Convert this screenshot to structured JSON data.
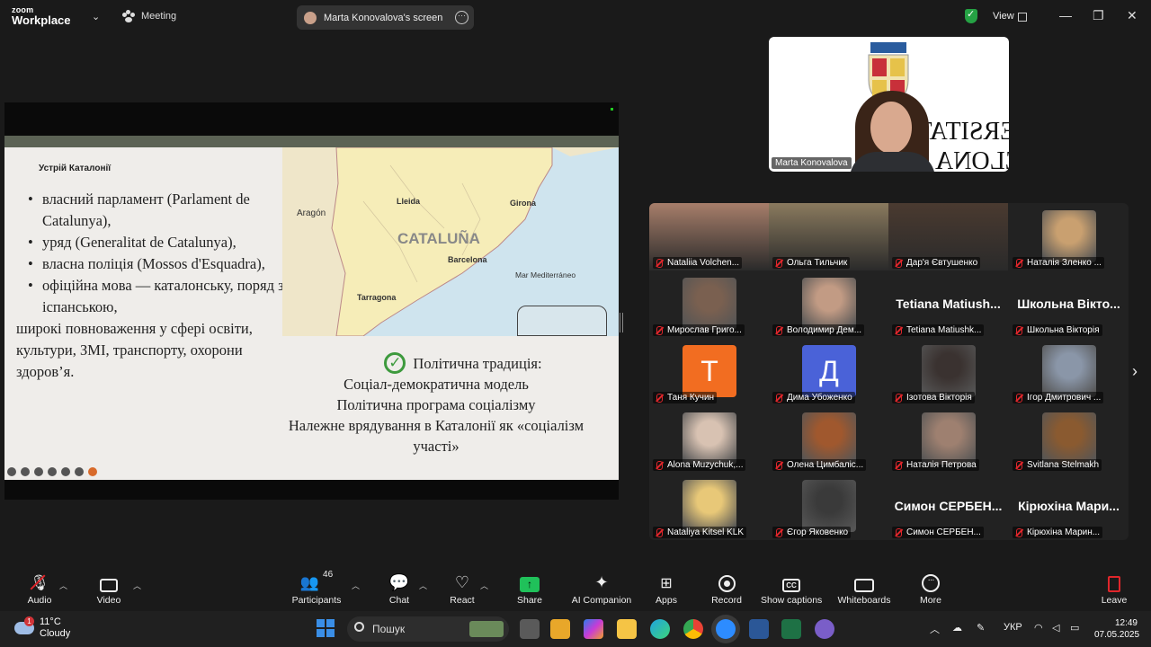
{
  "titlebar": {
    "logo_top": "zoom",
    "logo_bottom": "Workplace",
    "meeting_label": "Meeting",
    "share_pill": "Marta Konovalova's screen",
    "view_label": "View",
    "minimize": "—",
    "restore": "❐",
    "close": "✕"
  },
  "slide": {
    "heading": "Устрій Каталонії",
    "bullets": [
      "власний парламент (Parlament de Catalunya),",
      "уряд (Generalitat de Catalunya),",
      "власна поліція (Mossos d'Esquadra),",
      "офіційна мова — каталонську, поряд з іспанською,"
    ],
    "plain_text": "широкі повноваження у сфері освіти, культури, ЗМІ, транспорту, охорони здоров’я.",
    "map_labels": {
      "aragon": "Aragón",
      "lleida": "Lleida",
      "girona": "Girona",
      "cataluna": "CATALUÑA",
      "barcelona": "Barcelona",
      "tarragona": "Tarragona",
      "mar": "Mar Mediterráneo"
    },
    "tradition_title": "Політична традиція:",
    "tradition_lines": [
      "Соціал-демократична модель",
      "Політична програма соціалізму",
      "Належне врядування в Каталонії як «соціалізм участі»"
    ]
  },
  "speaker": {
    "name": "Marta Konovalova",
    "backdrop_line1": "UNIVERSITAT DE",
    "backdrop_line2": "BARCELONA"
  },
  "gallery": [
    {
      "name": "Nataliia Volchen...",
      "kind": "photo",
      "color": "#a77e6a"
    },
    {
      "name": "Ольга Тильчик",
      "kind": "photo",
      "color": "#8a7a5e"
    },
    {
      "name": "Дар'я Євтушенко",
      "kind": "photo",
      "color": "#4a3a30"
    },
    {
      "name": "Наталія Зленко ...",
      "kind": "small",
      "color": "#c9a070"
    },
    {
      "name": "Мирослав Григо...",
      "kind": "small",
      "color": "#7a6050"
    },
    {
      "name": "Володимир Дем...",
      "kind": "small",
      "color": "#c29b84"
    },
    {
      "name": "Tetiana Matiushk...",
      "kind": "text",
      "bigname": "Tetiana  Matiush..."
    },
    {
      "name": "Школьна Вікторія",
      "kind": "text",
      "bigname": "Школьна  Вікто..."
    },
    {
      "name": "Таня Кучин",
      "kind": "letter",
      "letter": "T",
      "color": "#f26d21"
    },
    {
      "name": "Дима Убоженко",
      "kind": "letter",
      "letter": "Д",
      "color": "#4a62d8"
    },
    {
      "name": "Ізотова Вікторія",
      "kind": "small",
      "color": "#3a3230"
    },
    {
      "name": "Ігор Дмитрович ...",
      "kind": "small",
      "color": "#8a96a8"
    },
    {
      "name": "Alona Muzychuk,...",
      "kind": "small",
      "color": "#d8c2b2"
    },
    {
      "name": "Олена Цимбаліс...",
      "kind": "small",
      "color": "#a0582e"
    },
    {
      "name": "Наталія Петрова",
      "kind": "small",
      "color": "#9e8070"
    },
    {
      "name": "Svitlana Stelmakh",
      "kind": "small",
      "color": "#8a5a30"
    },
    {
      "name": "Nataliya Kitsel KLK",
      "kind": "small",
      "color": "#e8c878"
    },
    {
      "name": "Єгор Яковенко",
      "kind": "small",
      "color": "#3a3a3a"
    },
    {
      "name": "Симон СЕРБЕН...",
      "kind": "text",
      "bigname": "Симон  СЕРБЕН..."
    },
    {
      "name": "Кірюхіна Марин...",
      "kind": "text",
      "bigname": "Кірюхіна  Мари..."
    }
  ],
  "toolbar": {
    "audio": "Audio",
    "video": "Video",
    "participants": "Participants",
    "participants_count": "46",
    "chat": "Chat",
    "react": "React",
    "share": "Share",
    "ai": "AI Companion",
    "apps": "Apps",
    "record": "Record",
    "captions": "Show captions",
    "captions_icon": "CC",
    "whiteboards": "Whiteboards",
    "more": "More",
    "leave": "Leave"
  },
  "taskbar": {
    "temp": "11°C",
    "weather": "Cloudy",
    "weather_badge": "1",
    "search": "Пошук",
    "lang": "УКР",
    "time": "12:49",
    "date": "07.05.2025"
  }
}
